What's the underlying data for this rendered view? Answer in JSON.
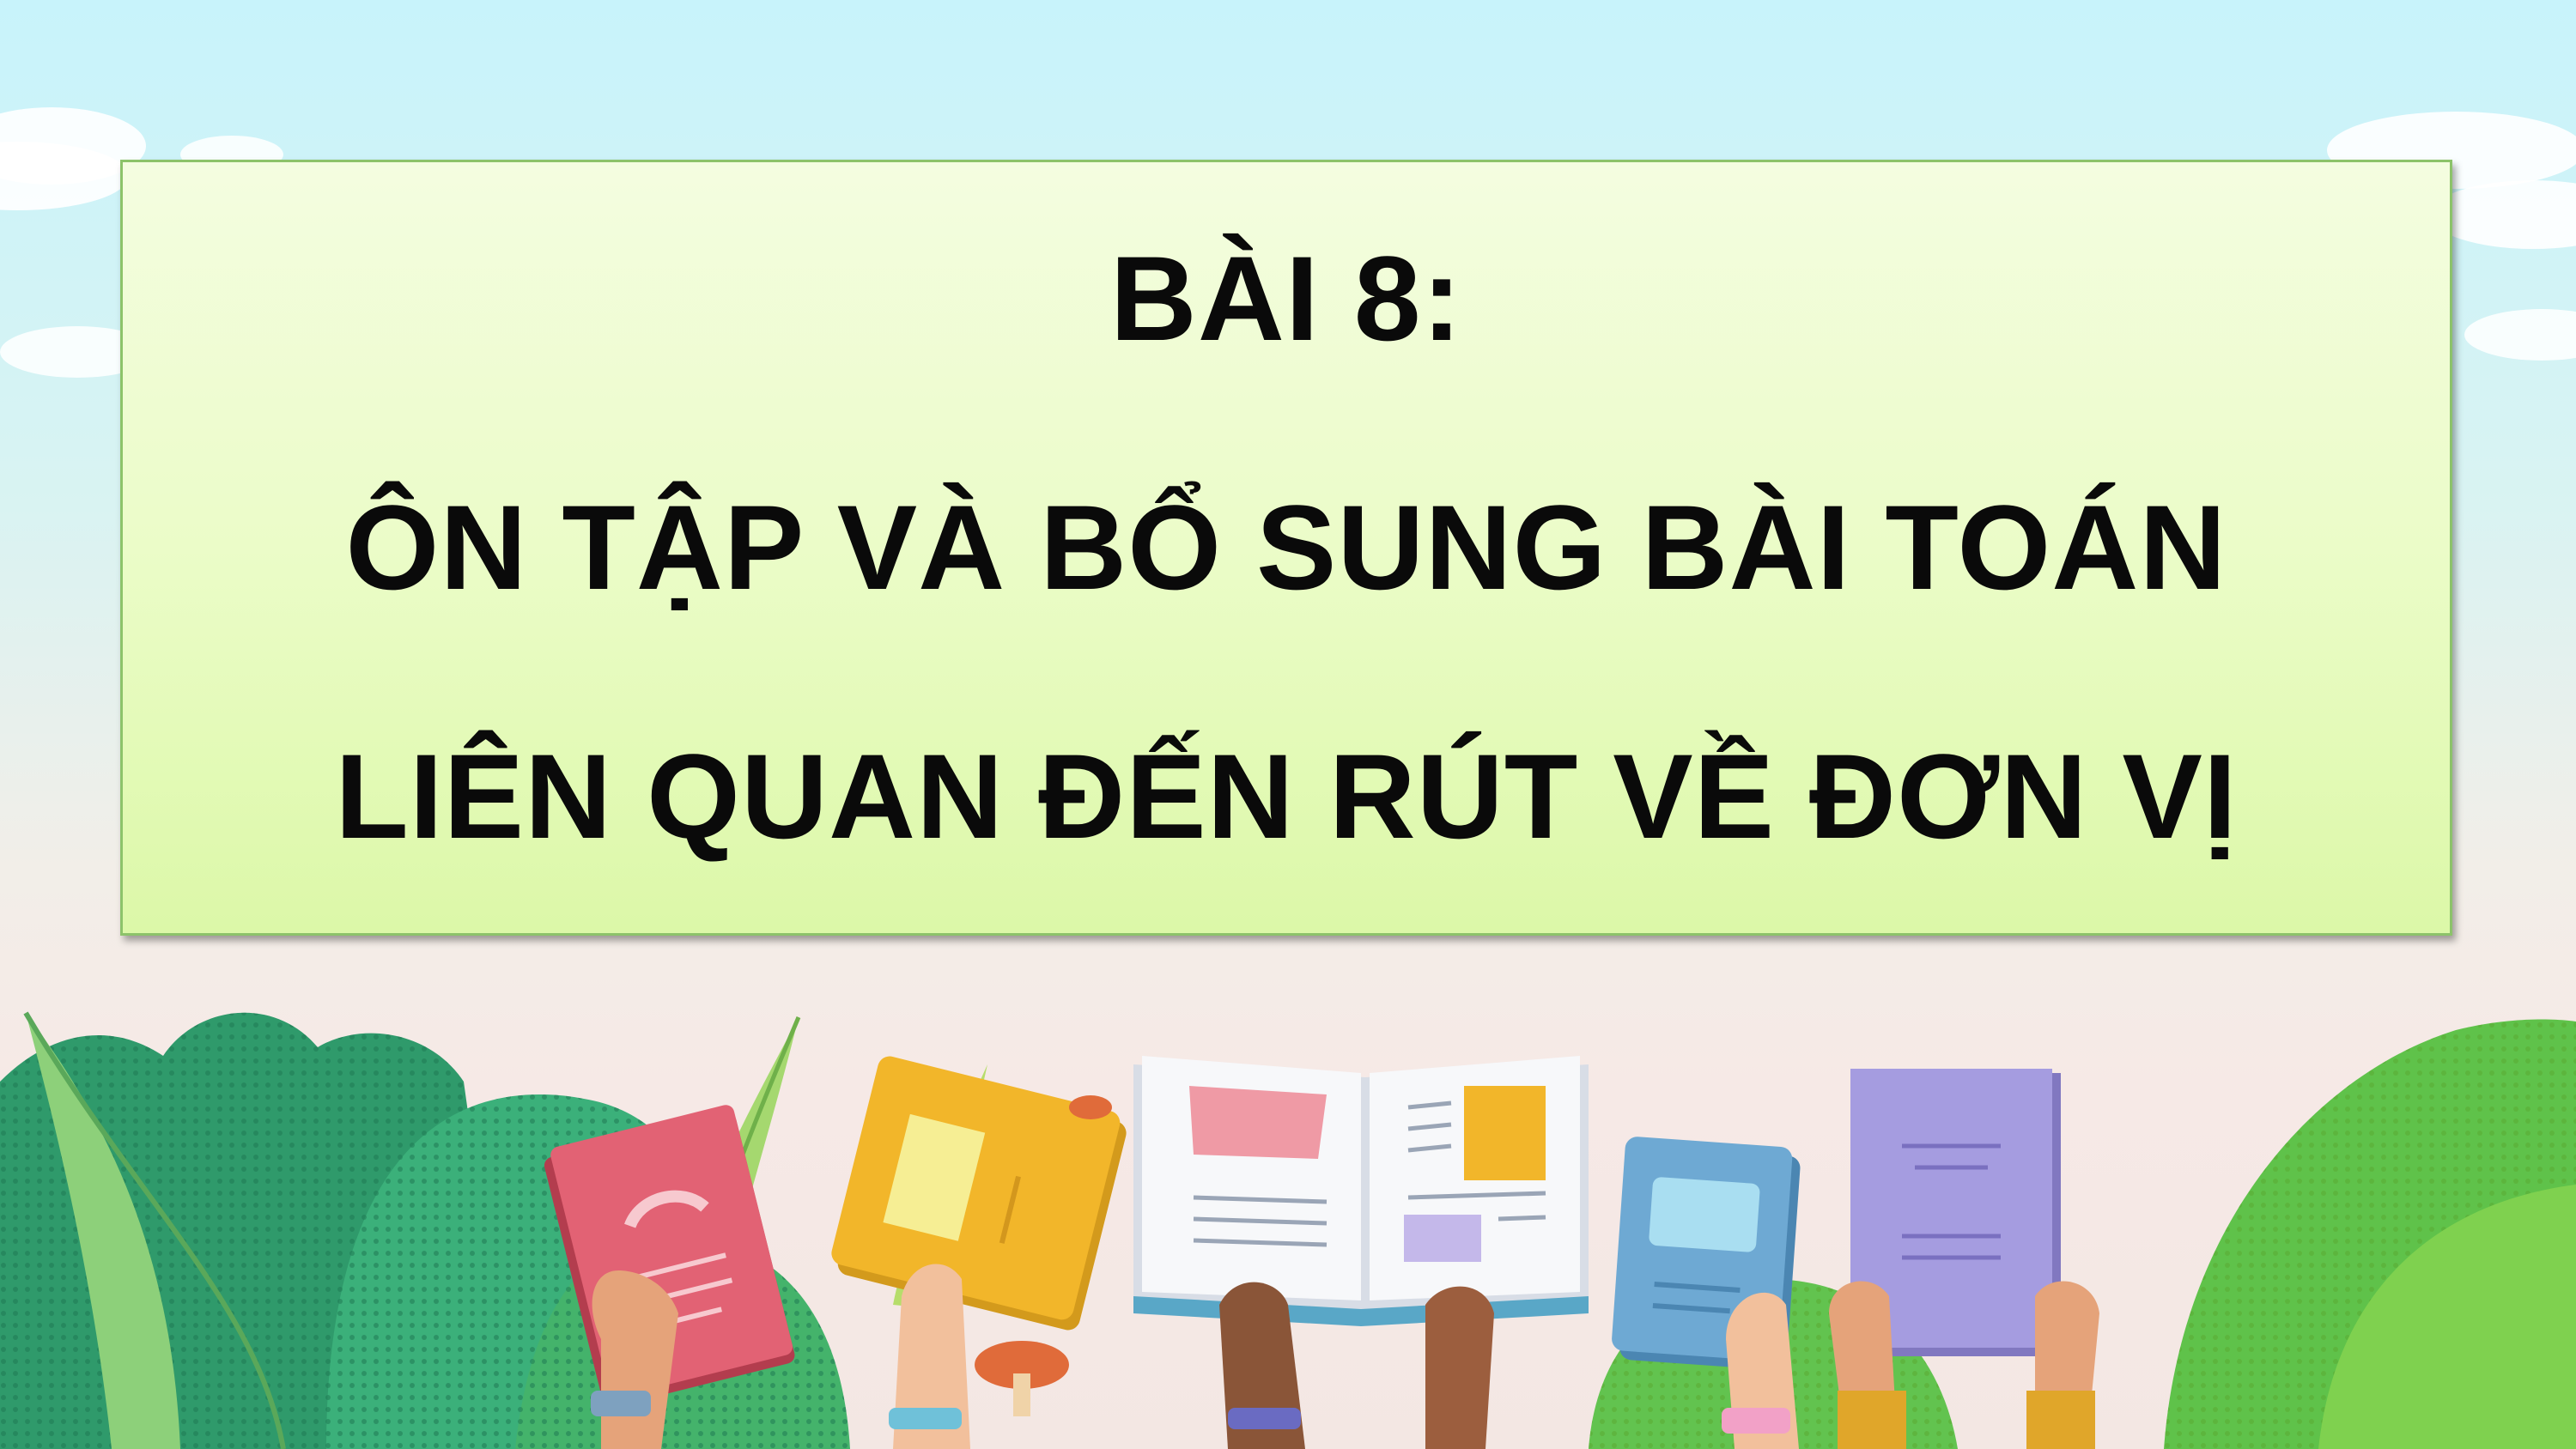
{
  "slide": {
    "title_lines": [
      "BÀI 8:",
      "ÔN TẬP VÀ BỔ SUNG BÀI TOÁN",
      "LIÊN QUAN ĐẾN RÚT VỀ ĐƠN VỊ"
    ]
  },
  "colors": {
    "sky_top": "#c8f3fb",
    "title_box_fill": "#ebfcc8",
    "title_box_border": "#8cc36a",
    "title_text": "#0a0a0a"
  },
  "illustration": {
    "icons": [
      "cloud-icon",
      "leaf-icon",
      "bush-icon",
      "hand-icon",
      "book-icon",
      "open-book-icon"
    ]
  }
}
